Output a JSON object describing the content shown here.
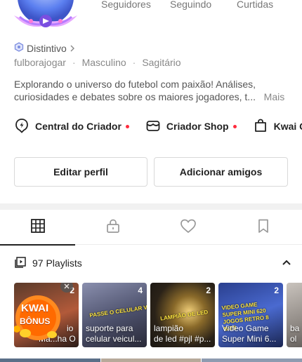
{
  "stats": {
    "followers_label": "Seguidores",
    "following_label": "Seguindo",
    "likes_label": "Curtidas"
  },
  "profile": {
    "badge_label": "Distintivo",
    "username": "fulborajogar",
    "gender": "Masculino",
    "zodiac": "Sagitário",
    "bio_line1": "Explorando o universo do futebol com paixão! Análises,",
    "bio_line2": "curiosidades e debates sobre os maiores jogadores, t...",
    "bio_more": "Mais"
  },
  "links": {
    "creator_center": "Central do Criador",
    "creator_shop": "Criador Shop",
    "kwai": "Kwai G"
  },
  "buttons": {
    "edit_profile": "Editar perfil",
    "add_friends": "Adicionar amigos"
  },
  "tabs": {
    "active": "grid",
    "items": [
      "grid-icon",
      "lock-icon",
      "heart-icon",
      "bookmark-icon"
    ]
  },
  "playlists": {
    "label": "97 Playlists",
    "items": [
      {
        "count": "2",
        "caption1": "io",
        "caption2": "Ma...ha On...",
        "promo_title": "KWAI",
        "promo_sub": "BÔNUS"
      },
      {
        "count": "4",
        "caption1": "suporte para",
        "caption2": "celular veicul...",
        "tag": "PASSE O CELULAR VEICULAR"
      },
      {
        "count": "2",
        "caption1": "lampião",
        "caption2": "de led #pjl #p...",
        "tag": "LAMPIÃO DE LED"
      },
      {
        "count": "2",
        "caption1": "Video Game",
        "caption2": "Super Mini 6...",
        "tag": "VIDEO GAME SUPER MINI 620 JOGOS RETRO 8 BITS"
      },
      {
        "count": "",
        "caption1": "ba",
        "caption2": "ol",
        "tag": ""
      }
    ]
  },
  "colors": {
    "accent_red": "#ff2b3d",
    "badge_blue": "#7c8de0",
    "promo_orange": "#ff8a1f"
  }
}
